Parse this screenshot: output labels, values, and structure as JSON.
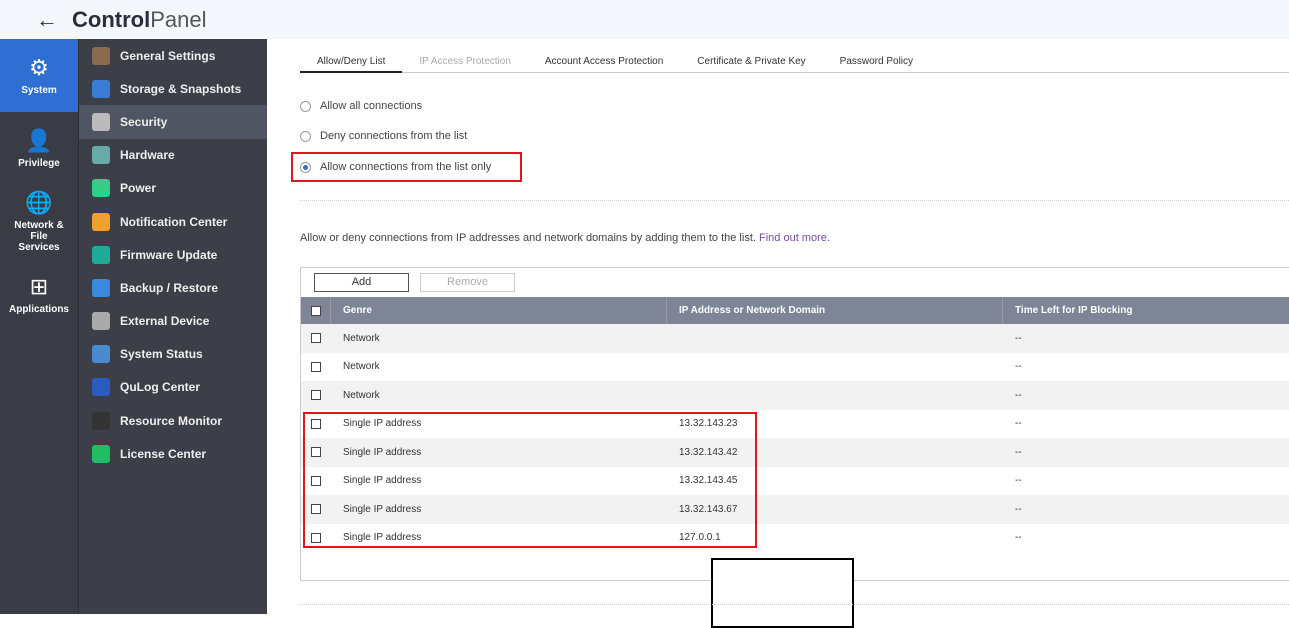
{
  "header": {
    "title_bold": "Control",
    "title_light": "Panel"
  },
  "nav": [
    {
      "label": "System",
      "icon": "gear-icon"
    },
    {
      "label": "Privilege",
      "icon": "user-icon"
    },
    {
      "label": "Network & File Services",
      "icon": "globe-icon"
    },
    {
      "label": "Applications",
      "icon": "grid-icon"
    }
  ],
  "submenu": [
    "General Settings",
    "Storage & Snapshots",
    "Security",
    "Hardware",
    "Power",
    "Notification Center",
    "Firmware Update",
    "Backup / Restore",
    "External Device",
    "System Status",
    "QuLog Center",
    "Resource Monitor",
    "License Center"
  ],
  "tabs": [
    "Allow/Deny List",
    "IP Access Protection",
    "Account Access Protection",
    "Certificate & Private Key",
    "Password Policy"
  ],
  "radios": [
    "Allow all connections",
    "Deny connections from the list",
    "Allow connections from the list only"
  ],
  "description": "Allow or deny connections from IP addresses and network domains by adding them to the list.",
  "find_out_more": "Find out more.",
  "buttons": {
    "add": "Add",
    "remove": "Remove"
  },
  "columns": [
    "Genre",
    "IP Address or Network Domain",
    "Time Left for IP Blocking"
  ],
  "rows": [
    {
      "genre": "Network",
      "ip": "",
      "time": "--"
    },
    {
      "genre": "Network",
      "ip": "",
      "time": "--"
    },
    {
      "genre": "Network",
      "ip": "",
      "time": "--"
    },
    {
      "genre": "Single IP address",
      "ip": "13.32.143.23",
      "time": "--"
    },
    {
      "genre": "Single IP address",
      "ip": "13.32.143.42",
      "time": "--"
    },
    {
      "genre": "Single IP address",
      "ip": "13.32.143.45",
      "time": "--"
    },
    {
      "genre": "Single IP address",
      "ip": "13.32.143.67",
      "time": "--"
    },
    {
      "genre": "Single IP address",
      "ip": "127.0.0.1",
      "time": "--"
    }
  ]
}
